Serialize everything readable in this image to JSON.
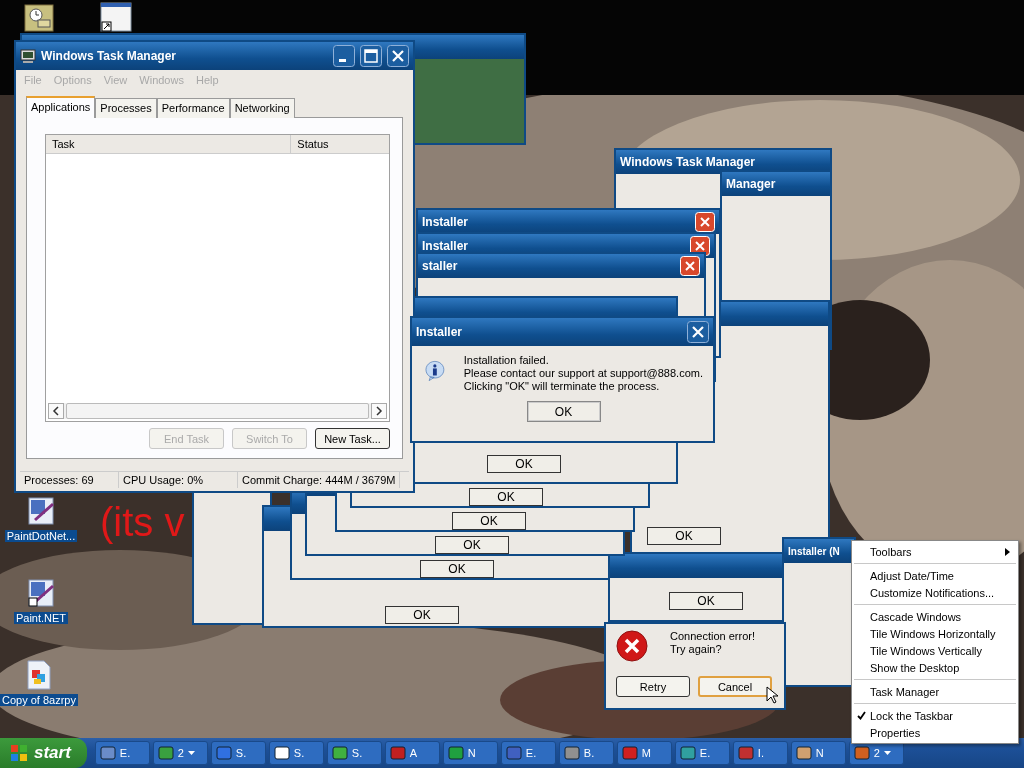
{
  "desktop_icons": [
    {
      "label": "PaintDotNet..."
    },
    {
      "label": "Paint.NET"
    },
    {
      "label": "Copy of 8azrpy"
    }
  ],
  "overlay_text": "(its v",
  "background_windows": [
    {
      "title": "Windows Task Manager"
    },
    {
      "title": "Manager"
    },
    {
      "button": "OK"
    },
    {
      "button": "OK"
    },
    {
      "button": "OK"
    },
    {
      "button": "OK"
    },
    {
      "button": "OK"
    },
    {
      "button": "OK"
    },
    {
      "button": "OK"
    },
    {
      "title": "Installer"
    },
    {
      "title": "Installer"
    },
    {
      "title": "staller"
    },
    {
      "button": "OK"
    },
    {
      "title": "Installer (N"
    }
  ],
  "task_manager": {
    "title": "Windows Task Manager",
    "menu": [
      {
        "label": "File",
        "disabled": true
      },
      {
        "label": "Options",
        "disabled": true
      },
      {
        "label": "View",
        "disabled": true
      },
      {
        "label": "Windows",
        "disabled": true
      },
      {
        "label": "Help",
        "disabled": true
      }
    ],
    "tabs": [
      {
        "label": "Applications",
        "selected": true
      },
      {
        "label": "Processes",
        "selected": false
      },
      {
        "label": "Performance",
        "selected": false
      },
      {
        "label": "Networking",
        "selected": false
      }
    ],
    "columns": [
      "Task",
      "Status"
    ],
    "buttons": [
      {
        "label": "End Task",
        "disabled": true
      },
      {
        "label": "Switch To",
        "disabled": true
      },
      {
        "label": "New Task...",
        "disabled": false
      }
    ],
    "status_bar": [
      "Processes: 69",
      "CPU Usage: 0%",
      "Commit Charge: 444M / 3679M"
    ]
  },
  "installer_dialog": {
    "title": "Installer",
    "lines": [
      "Installation failed.",
      "Please contact our support at support@888.com.",
      "Clicking \"OK\" will terminate the process."
    ],
    "button": "OK"
  },
  "error_dialog": {
    "lines": [
      "Connection error!",
      "Try again?"
    ],
    "buttons": [
      {
        "label": "Retry",
        "default": false
      },
      {
        "label": "Cancel",
        "default": true
      }
    ]
  },
  "context_menu": {
    "groups": [
      [
        {
          "label": "Toolbars",
          "submenu": true,
          "checked": false
        }
      ],
      [
        {
          "label": "Adjust Date/Time",
          "submenu": false,
          "checked": false
        },
        {
          "label": "Customize Notifications...",
          "submenu": false,
          "checked": false
        }
      ],
      [
        {
          "label": "Cascade Windows",
          "submenu": false,
          "checked": false
        },
        {
          "label": "Tile Windows Horizontally",
          "submenu": false,
          "checked": false
        },
        {
          "label": "Tile Windows Vertically",
          "submenu": false,
          "checked": false
        },
        {
          "label": "Show the Desktop",
          "submenu": false,
          "checked": false
        }
      ],
      [
        {
          "label": "Task Manager",
          "submenu": false,
          "checked": false
        }
      ],
      [
        {
          "label": "Lock the Taskbar",
          "submenu": false,
          "checked": true
        },
        {
          "label": "Properties",
          "submenu": false,
          "checked": false
        }
      ]
    ]
  },
  "taskbar": {
    "start": "start",
    "items": [
      {
        "label": "E.",
        "caret": false
      },
      {
        "label": "2",
        "caret": true
      },
      {
        "label": "S.",
        "caret": false
      },
      {
        "label": "S.",
        "caret": false
      },
      {
        "label": "S.",
        "caret": false
      },
      {
        "label": "A",
        "caret": false
      },
      {
        "label": "N",
        "caret": false
      },
      {
        "label": "E.",
        "caret": false
      },
      {
        "label": "B.",
        "caret": false
      },
      {
        "label": "M",
        "caret": false
      },
      {
        "label": "E.",
        "caret": false
      },
      {
        "label": "I.",
        "caret": false
      },
      {
        "label": "N",
        "caret": false
      },
      {
        "label": "2",
        "caret": true
      }
    ]
  }
}
